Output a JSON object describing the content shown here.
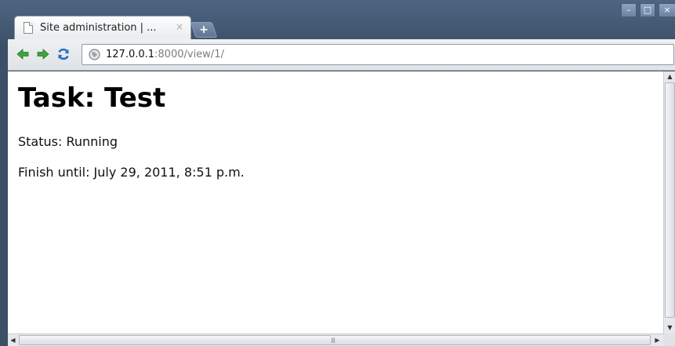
{
  "browser": {
    "tab": {
      "title": "Site administration | ...",
      "close": "×"
    },
    "new_tab": "+",
    "window_controls": {
      "minimize": "–",
      "maximize": "□",
      "close": "×"
    },
    "toolbar": {
      "back_icon": "back-arrow-icon",
      "forward_icon": "forward-arrow-icon",
      "reload_icon": "reload-icon"
    },
    "address": {
      "host": "127.0.0.1",
      "rest": ":8000/view/1/"
    }
  },
  "page": {
    "heading": "Task: Test",
    "status": "Status: Running",
    "finish": "Finish until: July 29, 2011, 8:51 p.m."
  },
  "scrollbars": {
    "grip": "III"
  },
  "colors": {
    "frame": "#3d5068",
    "arrow_green": "#3aa53a",
    "reload_blue": "#2c6fc1"
  }
}
